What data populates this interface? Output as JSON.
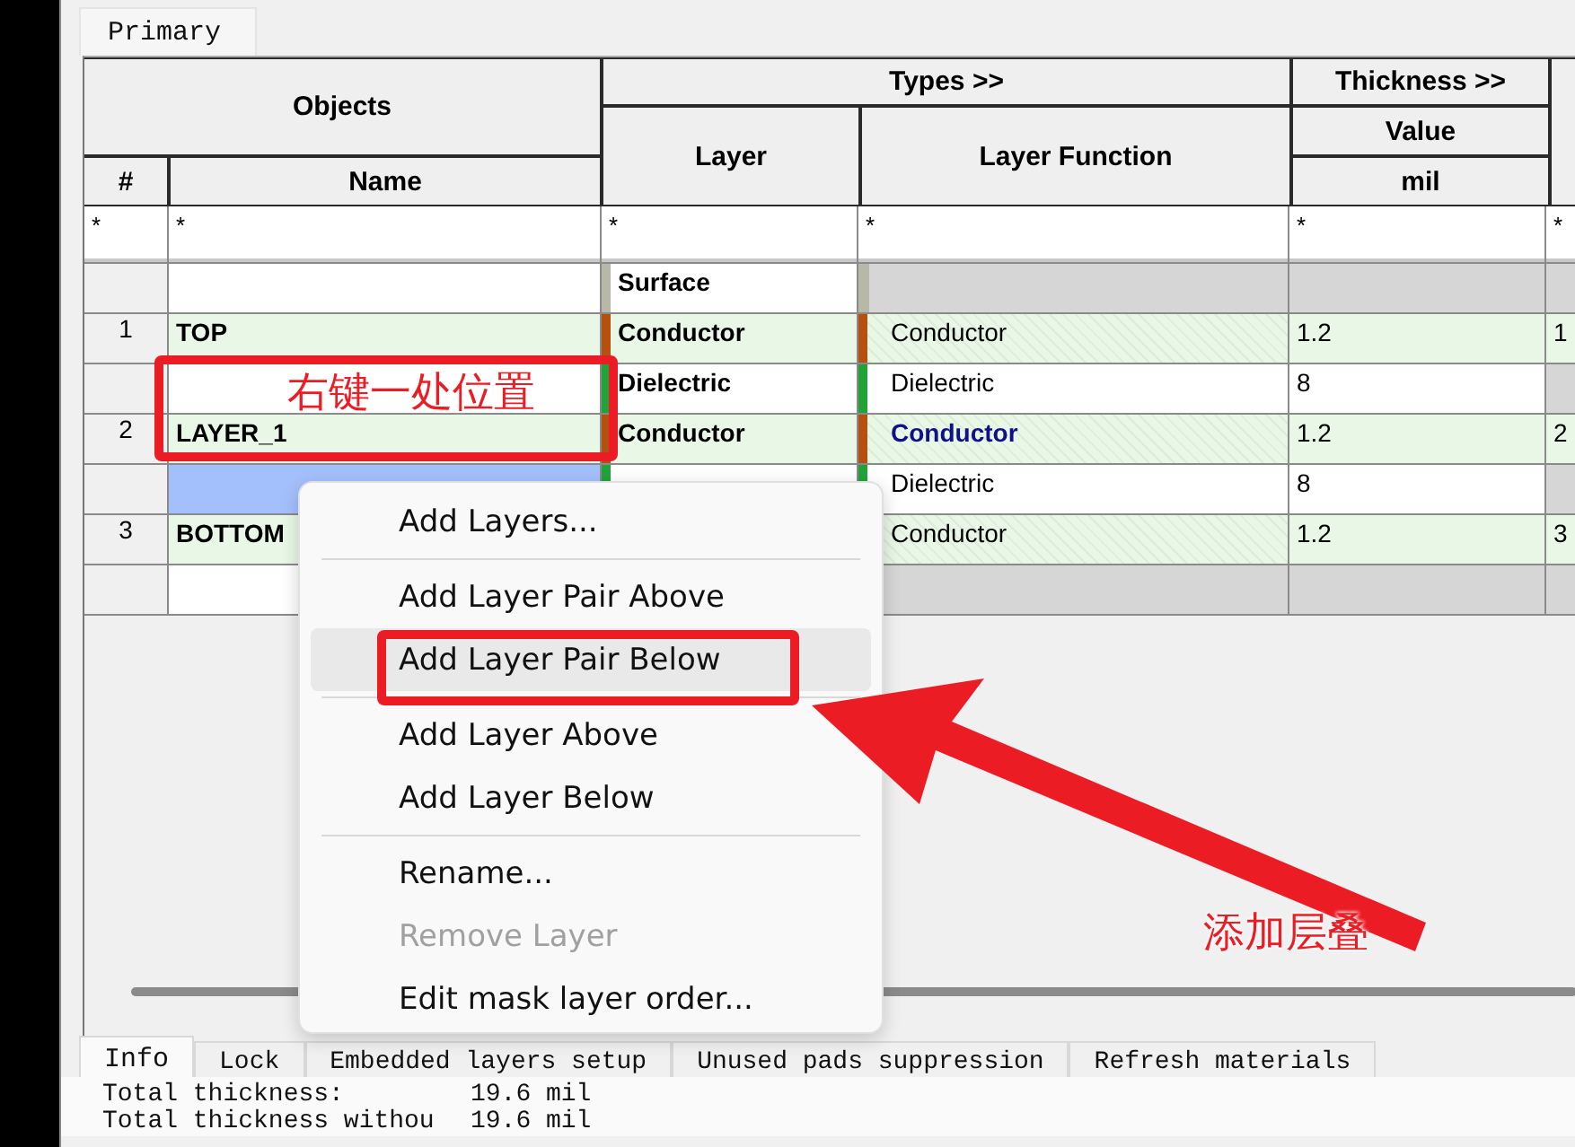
{
  "top_tabs": [
    {
      "label": "Primary",
      "selected": true
    }
  ],
  "table": {
    "column_groups": [
      "Objects",
      "Types >>",
      "Thickness >>"
    ],
    "columns": {
      "number": "#",
      "name": "Name",
      "layer": "Layer",
      "function": "Layer Function",
      "thickness": "Value",
      "thickness_unit": "mil"
    },
    "filters": [
      "*",
      "*",
      "*",
      "*",
      "*",
      "*"
    ],
    "rows": [
      {
        "kind": "surface",
        "layer": "Surface",
        "color": "#b8b8a8",
        "selected": false,
        "highlighted": false
      },
      {
        "kind": "conductor",
        "number": "1",
        "name": "TOP",
        "layer": "Conductor",
        "color": "#b5500f",
        "function": "Conductor",
        "thickness": "1.2",
        "column_6": "1",
        "selected": false,
        "highlighted": false
      },
      {
        "kind": "dielectric",
        "layer": "Dielectric",
        "color": "#22a33a",
        "function": "Dielectric",
        "thickness": "8",
        "selected": false,
        "highlighted": false
      },
      {
        "kind": "conductor",
        "number": "2",
        "name": "LAYER_1",
        "layer": "Conductor",
        "color": "#b5500f",
        "function": "Conductor",
        "thickness": "1.2",
        "column_6": "2",
        "selected": false,
        "highlighted": true
      },
      {
        "kind": "dielectric",
        "color": "#22a33a",
        "function": "Dielectric",
        "thickness": "8",
        "selected": true,
        "highlighted": false
      },
      {
        "kind": "conductor",
        "number": "3",
        "name": "BOTTOM",
        "function": "Conductor",
        "thickness": "1.2",
        "column_6": "3",
        "selected": false,
        "highlighted": false
      },
      {
        "kind": "surface",
        "selected": false
      }
    ]
  },
  "context_menu": {
    "items": [
      {
        "kind": "item",
        "label": "Add Layers...",
        "selected": false,
        "disabled": false
      },
      {
        "kind": "separator"
      },
      {
        "kind": "item",
        "label": "Add Layer Pair Above",
        "selected": false,
        "disabled": false
      },
      {
        "kind": "item",
        "label": "Add Layer Pair Below",
        "selected": true,
        "disabled": false
      },
      {
        "kind": "separator"
      },
      {
        "kind": "item",
        "label": "Add Layer Above",
        "selected": false,
        "disabled": false
      },
      {
        "kind": "item",
        "label": "Add Layer Below",
        "selected": false,
        "disabled": false
      },
      {
        "kind": "separator"
      },
      {
        "kind": "item",
        "label": "Rename...",
        "selected": false,
        "disabled": false
      },
      {
        "kind": "item",
        "label": "Remove Layer",
        "selected": false,
        "disabled": true
      },
      {
        "kind": "item",
        "label": "Edit mask layer order...",
        "selected": false,
        "disabled": false
      }
    ]
  },
  "annotations": [
    {
      "kind": "box"
    },
    {
      "kind": "label",
      "text": "右键一处位置"
    },
    {
      "kind": "box"
    },
    {
      "kind": "arrow"
    },
    {
      "kind": "label",
      "text": "添加层叠"
    }
  ],
  "bottom_tabs": [
    {
      "label": "Info",
      "selected": true
    },
    {
      "label": "Lock",
      "selected": false
    },
    {
      "label": "Embedded layers setup",
      "selected": false
    },
    {
      "label": "Unused pads suppression",
      "selected": false
    },
    {
      "label": "Refresh materials",
      "selected": false
    }
  ],
  "info": [
    {
      "label": "Total thickness:",
      "value": "19.6 mil"
    },
    {
      "label": "Total thickness withou",
      "value": "19.6 mil"
    }
  ]
}
